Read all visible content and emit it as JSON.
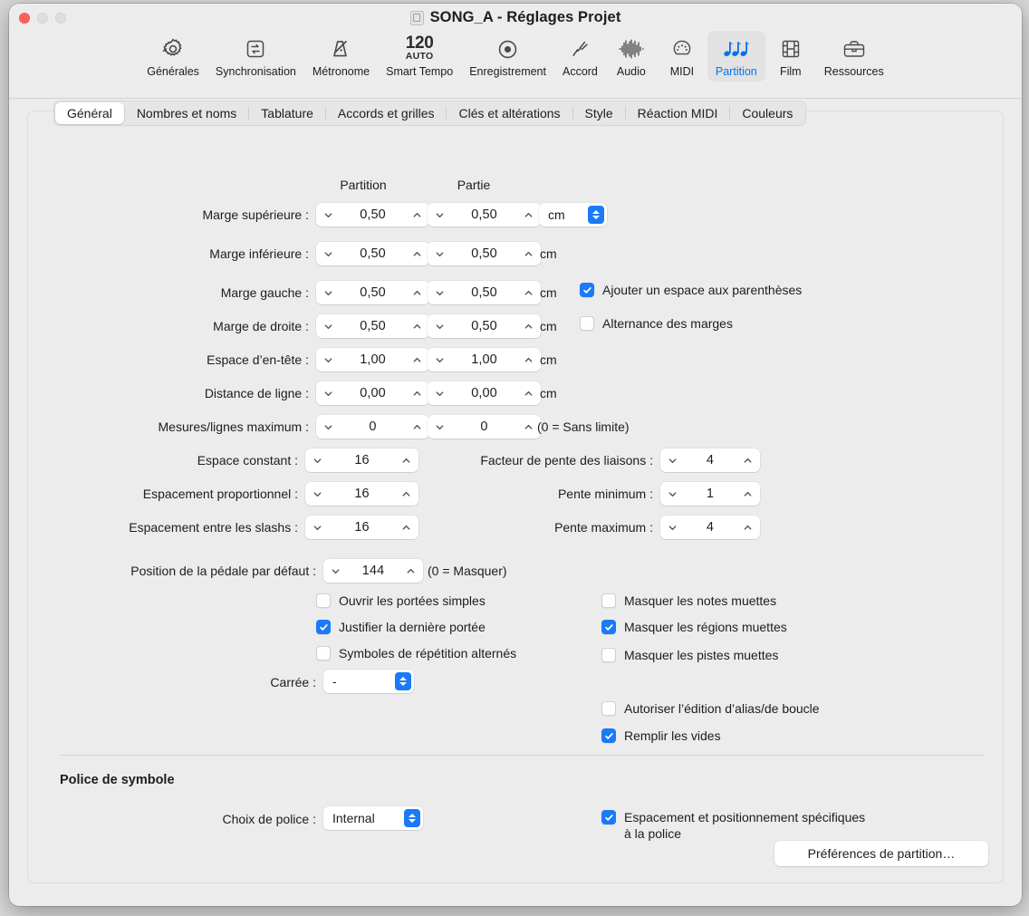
{
  "window": {
    "title": "SONG_A - Réglages Projet",
    "doc_icon": "document-icon",
    "traffic_lights": [
      "close",
      "minimize",
      "zoom"
    ]
  },
  "toolbar": {
    "items": [
      {
        "label": "Générales",
        "icon": "gear-icon",
        "selected": false
      },
      {
        "label": "Synchronisation",
        "icon": "sync-icon",
        "selected": false
      },
      {
        "label": "Métronome",
        "icon": "metronome-icon",
        "selected": false
      },
      {
        "label": "Smart Tempo",
        "icon": "tempo-icon",
        "selected": false,
        "tempo_value": "120",
        "tempo_mode": "AUTO"
      },
      {
        "label": "Enregistrement",
        "icon": "record-icon",
        "selected": false
      },
      {
        "label": "Accord",
        "icon": "tuning-fork-icon",
        "selected": false
      },
      {
        "label": "Audio",
        "icon": "waveform-icon",
        "selected": false
      },
      {
        "label": "MIDI",
        "icon": "midi-icon",
        "selected": false
      },
      {
        "label": "Partition",
        "icon": "notes-icon",
        "selected": true
      },
      {
        "label": "Film",
        "icon": "film-icon",
        "selected": false
      },
      {
        "label": "Ressources",
        "icon": "briefcase-icon",
        "selected": false
      }
    ],
    "accent_color": "#0a72e8"
  },
  "tabs": [
    {
      "label": "Général",
      "active": true
    },
    {
      "label": "Nombres et noms",
      "active": false
    },
    {
      "label": "Tablature",
      "active": false
    },
    {
      "label": "Accords et grilles",
      "active": false
    },
    {
      "label": "Clés et altérations",
      "active": false
    },
    {
      "label": "Style",
      "active": false
    },
    {
      "label": "Réaction MIDI",
      "active": false
    },
    {
      "label": "Couleurs",
      "active": false
    }
  ],
  "general": {
    "column_headers": {
      "score": "Partition",
      "part": "Partie"
    },
    "rows": [
      {
        "label": "Marge supérieure :",
        "score": "0,50",
        "part": "0,50",
        "unit": "cm"
      },
      {
        "label": "Marge inférieure :",
        "score": "0,50",
        "part": "0,50",
        "unit": "cm"
      },
      {
        "label": "Marge gauche :",
        "score": "0,50",
        "part": "0,50",
        "unit": "cm"
      },
      {
        "label": "Marge de droite :",
        "score": "0,50",
        "part": "0,50",
        "unit": "cm"
      },
      {
        "label": "Espace d’en-tête :",
        "score": "1,00",
        "part": "1,00",
        "unit": "cm"
      },
      {
        "label": "Distance de ligne :",
        "score": "0,00",
        "part": "0,00",
        "unit": "cm"
      },
      {
        "label": "Mesures/lignes maximum :",
        "score": "0",
        "part": "0",
        "unit": "(0 = Sans limite)"
      }
    ],
    "unit_popup": {
      "value": "cm"
    },
    "margin_checkboxes": [
      {
        "label": "Ajouter un espace aux parenthèses",
        "checked": true
      },
      {
        "label": "Alternance des marges",
        "checked": false
      }
    ],
    "spacing_left": [
      {
        "label": "Espace constant :",
        "value": "16"
      },
      {
        "label": "Espacement proportionnel :",
        "value": "16"
      },
      {
        "label": "Espacement entre les slashs :",
        "value": "16"
      }
    ],
    "spacing_right": [
      {
        "label": "Facteur de pente des liaisons :",
        "value": "4"
      },
      {
        "label": "Pente minimum :",
        "value": "1"
      },
      {
        "label": "Pente maximum :",
        "value": "4"
      }
    ],
    "pedal": {
      "label": "Position de la pédale par défaut :",
      "value": "144",
      "hint": "(0 = Masquer)"
    },
    "options_left": [
      {
        "label": "Ouvrir les portées simples",
        "checked": false
      },
      {
        "label": "Justifier la dernière portée",
        "checked": true
      },
      {
        "label": "Symboles de répétition alternés",
        "checked": false
      }
    ],
    "options_right": [
      {
        "label": "Masquer les notes muettes",
        "checked": false
      },
      {
        "label": "Masquer les régions muettes",
        "checked": true
      },
      {
        "label": "Masquer les pistes muettes",
        "checked": false
      }
    ],
    "options_right_lower": [
      {
        "label": "Autoriser l’édition d’alias/de boucle",
        "checked": false
      },
      {
        "label": "Remplir les vides",
        "checked": true
      }
    ],
    "carree": {
      "label": "Carrée :",
      "value": "-"
    }
  },
  "symbol_font": {
    "section_title": "Police de symbole",
    "font_choice_label": "Choix de police :",
    "font_choice_value": "Internal",
    "specific_spacing": {
      "label_line1": "Espacement et positionnement spécifiques",
      "label_line2": "à la police",
      "checked": true
    },
    "score_prefs_button": "Préférences de partition…"
  }
}
